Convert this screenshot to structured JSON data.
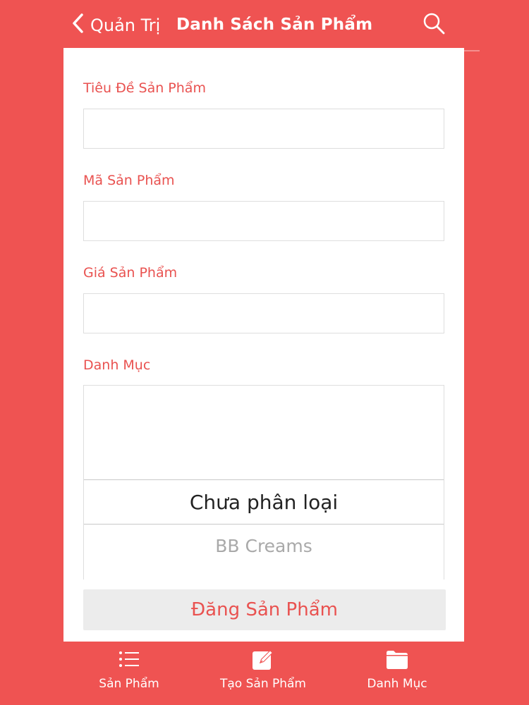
{
  "navbar": {
    "back_label": "Quản Trị",
    "title": "Danh Sách Sản Phẩm"
  },
  "form": {
    "title_label": "Tiêu Đề Sản Phẩm",
    "title_value": "",
    "code_label": "Mã Sản Phẩm",
    "code_value": "",
    "price_label": "Giá Sản Phẩm",
    "price_value": "",
    "category_label": "Danh Mục",
    "category_options": [
      "Chưa phân loại",
      "BB Creams"
    ],
    "selected_category": "Chưa phân loại",
    "submit_label": "Đăng Sản Phẩm"
  },
  "tabs": [
    {
      "label": "Sản Phẩm",
      "icon": "list-icon"
    },
    {
      "label": "Tạo Sản Phẩm",
      "icon": "compose-icon"
    },
    {
      "label": "Danh Mục",
      "icon": "folder-icon"
    }
  ],
  "colors": {
    "brand_red": "#ef5352",
    "label_red": "#e95250",
    "white": "#ffffff"
  }
}
